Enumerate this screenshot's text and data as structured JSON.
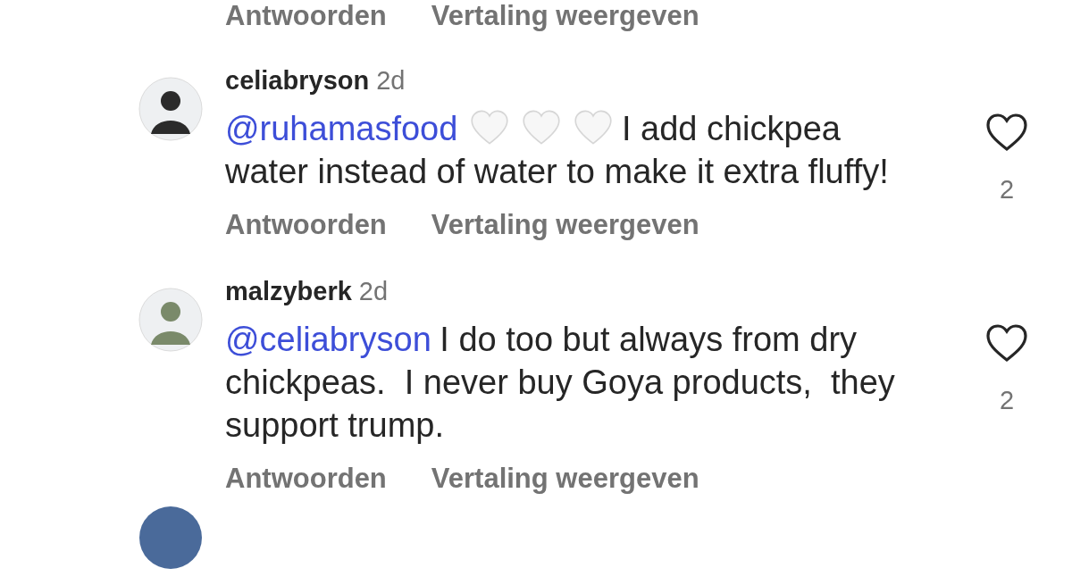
{
  "previous_actions": {
    "reply": "Antwoorden",
    "translate": "Vertaling weergeven"
  },
  "comments": [
    {
      "username": "celiabryson",
      "time": "2d",
      "avatar": {
        "color": "#2b2b2b"
      },
      "body": [
        {
          "kind": "mention",
          "text": "@ruhamasfood"
        },
        {
          "kind": "emoji-heart"
        },
        {
          "kind": "emoji-heart"
        },
        {
          "kind": "emoji-heart"
        },
        {
          "kind": "text",
          "text": "I add chickpea water instead of water to make it extra fluffy!"
        }
      ],
      "liked": false,
      "likes": "2",
      "reply": "Antwoorden",
      "translate": "Vertaling weergeven"
    },
    {
      "username": "malzyberk",
      "time": "2d",
      "avatar": {
        "color": "#7a8a6a"
      },
      "body": [
        {
          "kind": "mention",
          "text": "@celiabryson"
        },
        {
          "kind": "text",
          "text": "I do too but always from dry chickpeas.  I never buy Goya products,  they support trump."
        }
      ],
      "liked": false,
      "likes": "2",
      "reply": "Antwoorden",
      "translate": "Vertaling weergeven"
    }
  ],
  "next_comment": {
    "avatar": {
      "color": "#4a6a9a"
    }
  }
}
